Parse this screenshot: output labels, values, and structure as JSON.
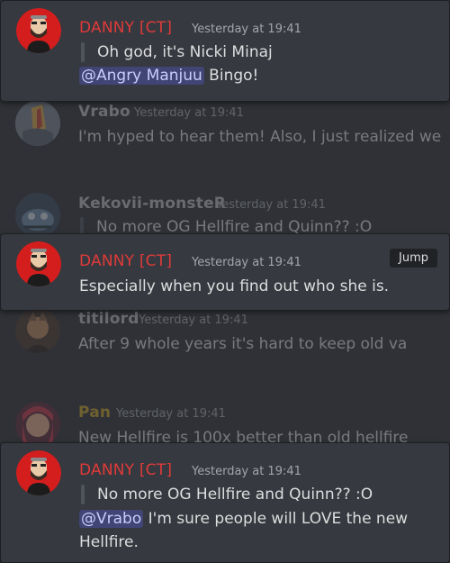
{
  "messages": [
    {
      "author": "DANNY [CT]",
      "timestamp": "Yesterday at 19:41",
      "quote": "Oh god, it's Nicki Minaj",
      "mention": "@Angry Manjuu",
      "text": " Bingo!"
    },
    {
      "author": "Vrabo",
      "timestamp": "Yesterday at 19:41",
      "text": "I'm hyped to hear them! Also, I just realized we"
    },
    {
      "author": "Kekovii-monsteR",
      "timestamp": "Yesterday at 19:41",
      "text": "No more OG Hellfire and Quinn?? :O"
    },
    {
      "author": "DANNY [CT]",
      "timestamp": "Yesterday at 19:41",
      "jump_label": "Jump",
      "text": "Especially when you find out who she is."
    },
    {
      "author": "titilord",
      "timestamp": "Yesterday at 19:41",
      "text": "After 9 whole years it's hard to keep old va"
    },
    {
      "author": "Pan",
      "timestamp": "Yesterday at 19:41",
      "text": "New Hellfire is 100x better than old hellfire"
    },
    {
      "author": "DANNY [CT]",
      "timestamp": "Yesterday at 19:41",
      "quote": "No more OG Hellfire and Quinn?? :O",
      "mention": "@Vrabo",
      "text": " I'm sure people will LOVE the new Hellfire."
    }
  ],
  "colors": {
    "danny": "#e03a3a",
    "vrabo": "#b9bbbe",
    "kekovii": "#b9bbbe",
    "titilord": "#b9bbbe",
    "pan": "#c9a227",
    "mention_bg": "#3c4270"
  }
}
